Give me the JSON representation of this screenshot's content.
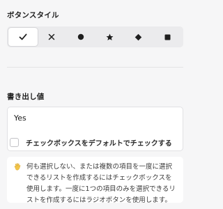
{
  "button_style": {
    "label": "ボタンスタイル",
    "options": [
      {
        "icon": "check-icon",
        "selected": true
      },
      {
        "icon": "cross-icon",
        "selected": false
      },
      {
        "icon": "circle-icon",
        "selected": false
      },
      {
        "icon": "star-icon",
        "selected": false
      },
      {
        "icon": "diamond-icon",
        "selected": false
      },
      {
        "icon": "square-icon",
        "selected": false
      }
    ]
  },
  "output_value": {
    "label": "書き出し値",
    "value": "Yes"
  },
  "default_check": {
    "label": "チェックボックスをデフォルトでチェックする",
    "checked": false
  },
  "info": {
    "icon": "waving-hand-icon",
    "text": "何も選択しない、または複数の項目を一度に選択できるリストを作成するにはチェックボックスを使用します。一度に1つの項目のみを選択できるリストを作成するにはラジオボタンを使用します。"
  },
  "colors": {
    "accent_icon": "#1f1f1f",
    "hand": "#f2c54a"
  }
}
